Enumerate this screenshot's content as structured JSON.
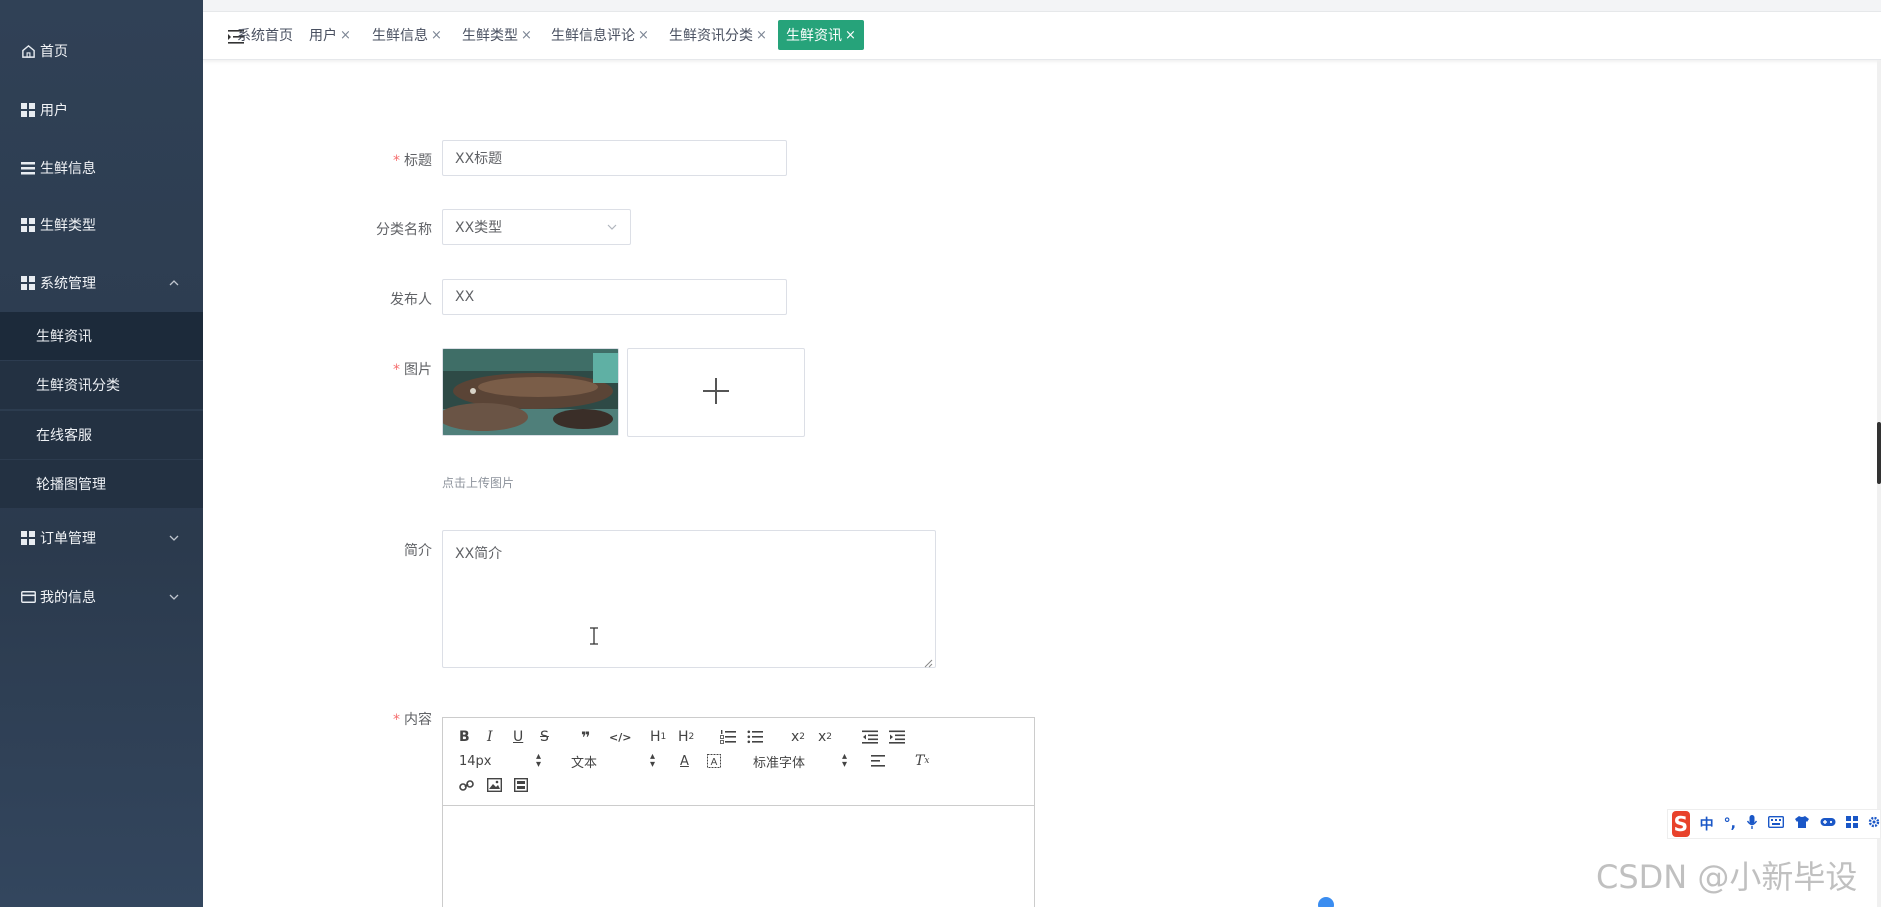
{
  "sidebar": {
    "items": [
      {
        "label": "首页",
        "icon": "home-icon"
      },
      {
        "label": "用户",
        "icon": "grid-icon"
      },
      {
        "label": "生鲜信息",
        "icon": "list-icon"
      },
      {
        "label": "生鲜类型",
        "icon": "grid-icon"
      },
      {
        "label": "系统管理",
        "icon": "grid-icon",
        "expanded": true
      },
      {
        "label": "订单管理",
        "icon": "grid-icon"
      },
      {
        "label": "我的信息",
        "icon": "card-icon"
      }
    ],
    "submenu": [
      {
        "label": "生鲜资讯",
        "active": true
      },
      {
        "label": "生鲜资讯分类"
      },
      {
        "label": "在线客服"
      },
      {
        "label": "轮播图管理"
      }
    ]
  },
  "tabs": [
    {
      "label": "系统首页",
      "closable": false
    },
    {
      "label": "用户",
      "closable": true
    },
    {
      "label": "生鲜信息",
      "closable": true
    },
    {
      "label": "生鲜类型",
      "closable": true
    },
    {
      "label": "生鲜信息评论",
      "closable": true
    },
    {
      "label": "生鲜资讯分类",
      "closable": true
    },
    {
      "label": "生鲜资讯",
      "closable": true,
      "active": true
    }
  ],
  "tab_close_glyph": "×",
  "form": {
    "title": {
      "label": "标题",
      "value": "XX标题",
      "required": true
    },
    "category": {
      "label": "分类名称",
      "value": "XX类型"
    },
    "publisher": {
      "label": "发布人",
      "value": "XX"
    },
    "image": {
      "label": "图片",
      "required": true,
      "hint": "点击上传图片"
    },
    "summary": {
      "label": "简介",
      "value": "XX简介"
    },
    "content": {
      "label": "内容",
      "required": true
    }
  },
  "editor": {
    "font_size": "14px",
    "paragraph": "文本",
    "font_family": "标准字体"
  },
  "ime": {
    "chinese": "中"
  },
  "watermark": "CSDN @小新毕设",
  "colors": {
    "accent": "#26a37a",
    "sidebar": "#304156",
    "required": "#f56c6c"
  }
}
